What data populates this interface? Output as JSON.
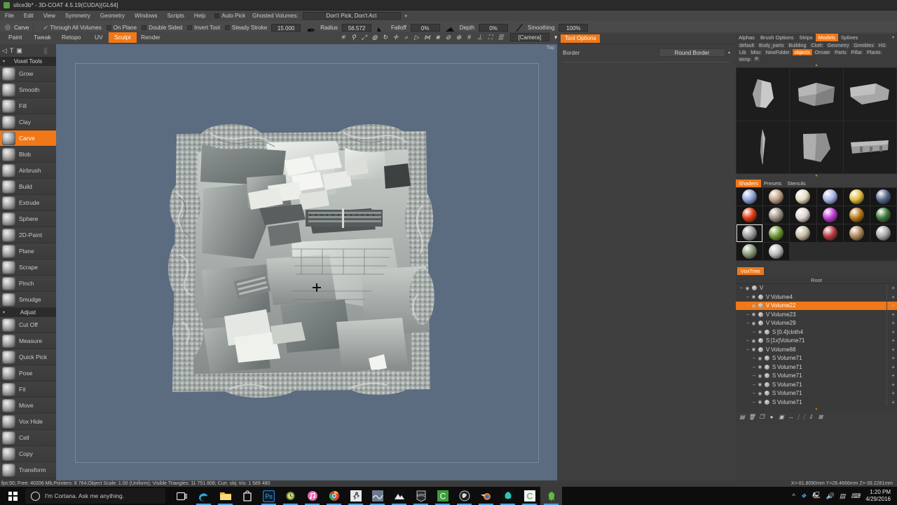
{
  "window": {
    "title": "slice3b* - 3D-COAT 4.5.19(CUDA)[GL64]",
    "app_icon": "3dcoat-icon"
  },
  "menubar": {
    "items": [
      "File",
      "Edit",
      "View",
      "Symmetry",
      "Geometry",
      "Windows",
      "Scripts",
      "Help"
    ],
    "auto_pick_label": "Auto Pick",
    "ghosted_volumes_label": "Ghosted Volumes:",
    "ghosted_volumes_value": "Don't Pick, Don't Act"
  },
  "toolbar": {
    "tool_name": "Carve",
    "checks": [
      {
        "label": "Through All Volumes",
        "checked": true
      },
      {
        "label": "On Plane",
        "checked": false
      },
      {
        "label": "Double Sided",
        "checked": false
      },
      {
        "label": "Invert Tool",
        "checked": false
      },
      {
        "label": "Steady Stroke",
        "checked": false
      }
    ],
    "steady_stroke_value": "15.000",
    "params": [
      {
        "label": "Radius",
        "value": "56.572"
      },
      {
        "label": "Falloff",
        "value": "0%"
      },
      {
        "label": "Depth",
        "value": "0%"
      },
      {
        "label": "Smoothing",
        "value": "100%"
      }
    ]
  },
  "moderow": {
    "modes": [
      "Paint",
      "Tweak",
      "Retopo",
      "UV",
      "Sculpt",
      "Render"
    ],
    "active_mode": "Sculpt",
    "icons": [
      "light-icon",
      "anchor-icon",
      "comet-icon",
      "drop-icon",
      "rotate-icon",
      "move-icon",
      "magnify-icon",
      "play-icon",
      "noise-icon",
      "mesh-icon",
      "forbidden-icon",
      "umbrella-icon",
      "grid-icon",
      "axis-icon",
      "fullscreen-icon",
      "flat-icon"
    ],
    "camera_value": "[Camera]",
    "tool_options_tab": "Tool Options"
  },
  "left_panel": {
    "header_glyph": "T",
    "groups": [
      {
        "title": "Voxel Tools",
        "tools": [
          "Grow",
          "Smooth",
          "Fill",
          "Clay",
          "Carve",
          "Blob",
          "Airbrush",
          "Build",
          "Extrude",
          "Sphere",
          "2D-Paint",
          "Plane",
          "Scrape",
          "Pinch",
          "Smudge"
        ]
      },
      {
        "title": "Adjust",
        "tools": [
          "Cut Off",
          "Measure",
          "Quick Pick",
          "Pose",
          "Fit",
          "Move",
          "Vox Hide",
          "Cell",
          "Copy",
          "Transform"
        ]
      }
    ],
    "selected_tool": "Carve"
  },
  "viewport": {
    "view_label": "Top"
  },
  "tool_options": {
    "title": "Tool Options",
    "rows": [
      {
        "label": "Border",
        "value": "Round Border"
      }
    ]
  },
  "right_panel": {
    "tabs": [
      "Alphas",
      "Brush Options",
      "Strips",
      "Models",
      "Splines"
    ],
    "active_tab": "Models",
    "folders": [
      "default",
      "Body_parts",
      "Building",
      "Cloth",
      "Geometry",
      "Greebles",
      "HS",
      "Lib",
      "Misc",
      "NewFolder",
      "objects",
      "Ornate",
      "Parts",
      "Pillar",
      "Plants",
      "temp"
    ],
    "active_folder": "objects",
    "models": [
      "rock-shard-1",
      "rock-chunk-2",
      "rock-slab-3",
      "rock-spike-4",
      "rock-wedge-5",
      "rock-beam-6"
    ],
    "shader_tabs": [
      "Shaders",
      "Presets",
      "Stencils"
    ],
    "active_shader_tab": "Shaders",
    "shaders": [
      {
        "name": "blue-glass",
        "color": "#8fa6d8"
      },
      {
        "name": "sandstone",
        "color": "#c0a183"
      },
      {
        "name": "cream-clay",
        "color": "#e4dcc0"
      },
      {
        "name": "flat-periwinkle",
        "color": "#a9b6ea"
      },
      {
        "name": "gold",
        "color": "#e3bc3c"
      },
      {
        "name": "steel-blue",
        "color": "#58678c"
      },
      {
        "name": "red-hot",
        "color": "#e33b14"
      },
      {
        "name": "mud",
        "color": "#9e9285"
      },
      {
        "name": "plaster",
        "color": "#dfd4cf"
      },
      {
        "name": "magenta-glow",
        "color": "#c13fd6"
      },
      {
        "name": "bronze",
        "color": "#b87a18"
      },
      {
        "name": "green-metal",
        "color": "#3f7a3a"
      },
      {
        "name": "gray-rock",
        "color": "#9d9d9d"
      },
      {
        "name": "olive-green",
        "color": "#6f9a33"
      },
      {
        "name": "pale-gold",
        "color": "#c9bda5"
      },
      {
        "name": "crimson",
        "color": "#bb3b42"
      },
      {
        "name": "copper",
        "color": "#b08a5b"
      },
      {
        "name": "silver",
        "color": "#a9a9a9"
      },
      {
        "name": "sage",
        "color": "#8a9a78"
      },
      {
        "name": "chrome",
        "color": "#bdbdbd"
      }
    ],
    "selected_shader": "gray-rock"
  },
  "voxtree": {
    "title": "VoxTree",
    "root_label": "Root",
    "rows": [
      {
        "indent": 0,
        "type": "V",
        "name": "",
        "selected": false
      },
      {
        "indent": 1,
        "type": "V",
        "name": "Volume4",
        "selected": false
      },
      {
        "indent": 1,
        "type": "V",
        "name": "Volume22",
        "selected": true
      },
      {
        "indent": 1,
        "type": "V",
        "name": "Volume23",
        "selected": false
      },
      {
        "indent": 1,
        "type": "V",
        "name": "Volume29",
        "selected": false
      },
      {
        "indent": 2,
        "type": "S",
        "name": "[0.4]cloth4",
        "selected": false
      },
      {
        "indent": 1,
        "type": "S",
        "name": "[1x]Volume71",
        "selected": false
      },
      {
        "indent": 1,
        "type": "V",
        "name": "Volume88",
        "selected": false
      },
      {
        "indent": 2,
        "type": "S",
        "name": "Volume71",
        "selected": false
      },
      {
        "indent": 2,
        "type": "S",
        "name": "Volume71",
        "selected": false
      },
      {
        "indent": 2,
        "type": "S",
        "name": "Volume71",
        "selected": false
      },
      {
        "indent": 2,
        "type": "S",
        "name": "Volume71",
        "selected": false
      },
      {
        "indent": 2,
        "type": "S",
        "name": "Volume71",
        "selected": false
      },
      {
        "indent": 2,
        "type": "S",
        "name": "Volume71",
        "selected": false
      }
    ],
    "toolbar_icons": [
      "new-layer-icon",
      "delete-icon",
      "duplicate-icon",
      "merge-icon",
      "save-icon",
      "swap-icon",
      "list-icon",
      "import-icon",
      "close-icon"
    ]
  },
  "status_bar": {
    "text": "fps:50;   Free: 40206 Mb,Pointers: 8 764;Object Scale: 1.00 (Uniform); Visible Triangles: 11 751 808; Curr. obj. tris: 1 589 480",
    "coords": "X=-81.8090mm  Y=26.4666mm  Z=-39.2281mm"
  },
  "taskbar": {
    "cortana_placeholder": "I'm Cortana. Ask me anything.",
    "apps": [
      "task-view-icon",
      "edge-icon",
      "file-explorer-icon",
      "store-icon",
      "photoshop-icon",
      "clock-icon",
      "itunes-icon",
      "chrome-icon",
      "runner-icon",
      "wave-icon",
      "mountain-icon",
      "epic-icon",
      "c-green-icon",
      "unreal-icon",
      "blender-icon",
      "teal-icon",
      "c-white-icon",
      "3dcoat-icon"
    ],
    "time": "1:20 PM",
    "date": "4/29/2016",
    "tray_icons": [
      "chevron-up-icon",
      "dropbox-icon",
      "network-icon",
      "volume-icon",
      "action-center-icon",
      "keyboard-icon"
    ]
  }
}
